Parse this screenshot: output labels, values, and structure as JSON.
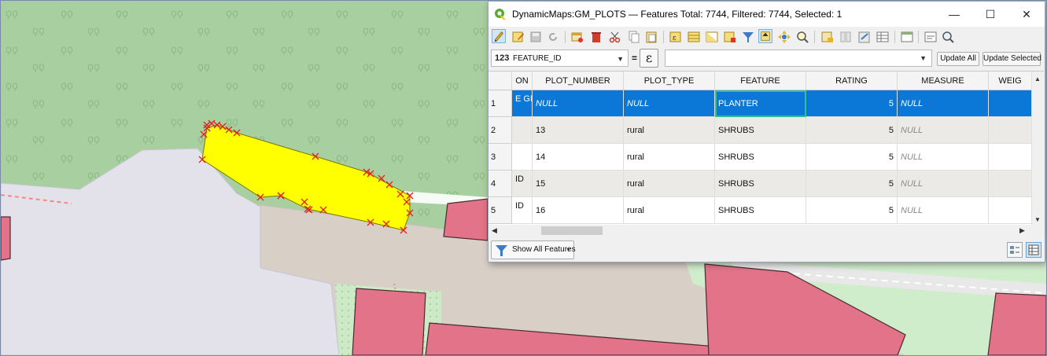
{
  "window": {
    "title": "DynamicMaps:GM_PLOTS — Features Total: 7744, Filtered: 7744, Selected: 1",
    "minimize_glyph": "—",
    "maximize_glyph": "☐",
    "close_glyph": "✕"
  },
  "toolbar": {
    "icons": [
      "pencil-edit-icon",
      "multi-edit-icon",
      "save-edits-icon",
      "reload-icon",
      "add-feature-icon",
      "delete-feature-icon",
      "cut-icon",
      "copy-icon",
      "paste-icon",
      "expression-select-icon",
      "select-all-icon",
      "invert-selection-icon",
      "deselect-icon",
      "filter-icon",
      "move-selection-top-icon",
      "pan-to-selection-icon",
      "zoom-to-selection-icon",
      "new-field-icon",
      "delete-field-icon",
      "field-calculator-icon",
      "conditional-format-icon",
      "dock-icon",
      "actions-icon",
      "zoom-map-icon"
    ]
  },
  "expression_bar": {
    "field_type": "123",
    "field_name": "FEATURE_ID",
    "equals": "=",
    "epsilon": "ε",
    "expression_value": "",
    "update_all": "Update All",
    "update_selected": "Update Selected"
  },
  "table": {
    "columns": [
      "ON",
      "PLOT_NUMBER",
      "PLOT_TYPE",
      "FEATURE",
      "RATING",
      "MEASURE",
      "WEIG"
    ],
    "rows": [
      {
        "num": "1",
        "on": "E GM",
        "plot_number": "NULL",
        "plot_type": "NULL",
        "feature": "PLANTER",
        "rating": "5",
        "measure": "NULL"
      },
      {
        "num": "2",
        "on": "",
        "plot_number": "13",
        "plot_type": "rural",
        "feature": "SHRUBS",
        "rating": "5",
        "measure": "NULL"
      },
      {
        "num": "3",
        "on": "",
        "plot_number": "14",
        "plot_type": "rural",
        "feature": "SHRUBS",
        "rating": "5",
        "measure": "NULL"
      },
      {
        "num": "4",
        "on": "ID",
        "plot_number": "15",
        "plot_type": "rural",
        "feature": "SHRUBS",
        "rating": "5",
        "measure": "NULL"
      },
      {
        "num": "5",
        "on": "ID",
        "plot_number": "16",
        "plot_type": "rural",
        "feature": "SHRUBS",
        "rating": "5",
        "measure": "NULL"
      }
    ],
    "selected_row": 1
  },
  "bottom": {
    "show_all_label": "Show All Features"
  },
  "colors": {
    "map_green": "#a8cf9f",
    "map_road": "#e3e1ea",
    "map_tan": "#d8cfc6",
    "building_pink": "#e27388",
    "selected_plot": "#ffff00",
    "vertex_marker": "#e3211b",
    "selection_blue": "#0b78d7"
  }
}
